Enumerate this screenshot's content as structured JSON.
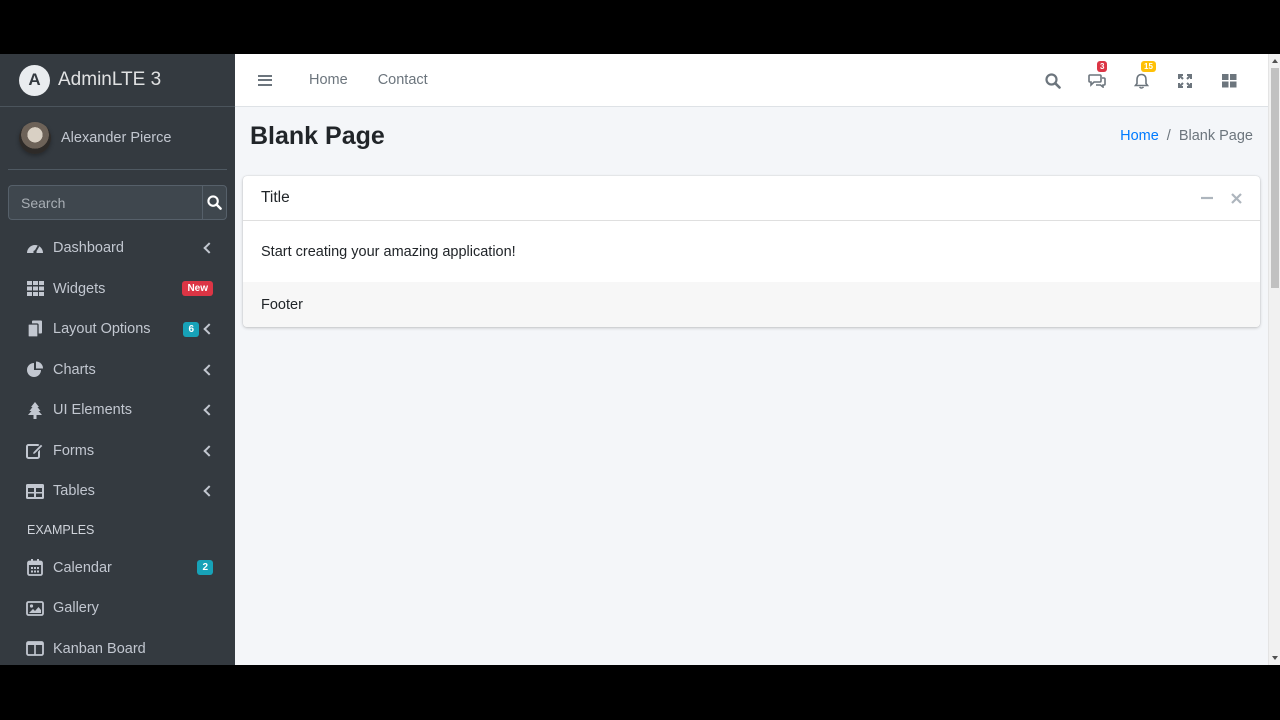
{
  "brand": {
    "name": "AdminLTE 3",
    "logo_letter": "A"
  },
  "user": {
    "name": "Alexander Pierce"
  },
  "search": {
    "placeholder": "Search"
  },
  "sidebar": {
    "items": [
      {
        "label": "Dashboard",
        "icon": "dashboard-icon"
      },
      {
        "label": "Widgets",
        "icon": "grid-icon",
        "badge": "New"
      },
      {
        "label": "Layout Options",
        "icon": "copy-icon",
        "badge": "6"
      },
      {
        "label": "Charts",
        "icon": "pie-chart-icon"
      },
      {
        "label": "UI Elements",
        "icon": "tree-icon"
      },
      {
        "label": "Forms",
        "icon": "edit-icon"
      },
      {
        "label": "Tables",
        "icon": "table-icon"
      }
    ],
    "header": "EXAMPLES",
    "examples": [
      {
        "label": "Calendar",
        "icon": "calendar-icon",
        "badge": "2"
      },
      {
        "label": "Gallery",
        "icon": "image-icon"
      },
      {
        "label": "Kanban Board",
        "icon": "columns-icon"
      }
    ]
  },
  "topbar": {
    "links": [
      "Home",
      "Contact"
    ],
    "messages_count": "3",
    "notifications_count": "15"
  },
  "page": {
    "title": "Blank Page"
  },
  "breadcrumb": {
    "home": "Home",
    "separator": "/",
    "active": "Blank Page"
  },
  "card": {
    "title": "Title",
    "body": "Start creating your amazing application!",
    "footer": "Footer"
  },
  "colors": {
    "sidebar": "#343a40",
    "link": "#007bff",
    "badge_danger": "#dc3545",
    "badge_info": "#17a2b8",
    "badge_warning": "#ffc107"
  }
}
